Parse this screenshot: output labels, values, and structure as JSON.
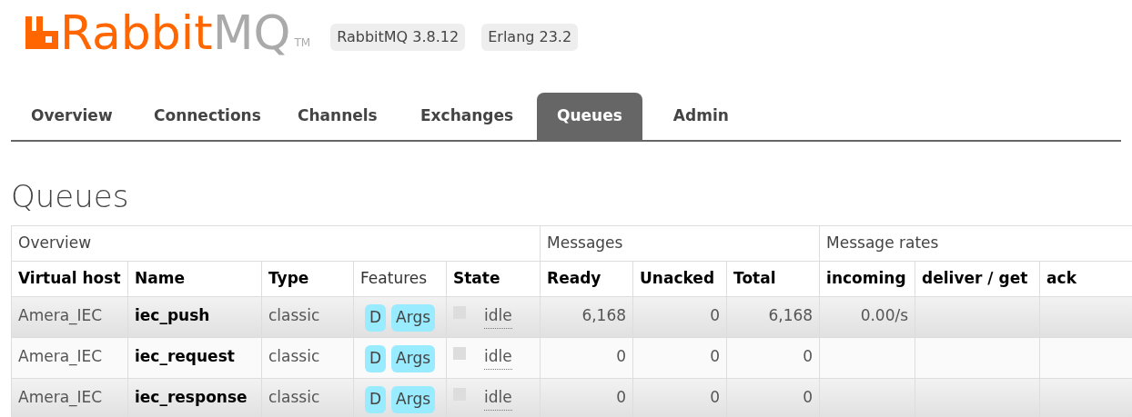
{
  "logo": {
    "brand": "Rabbit",
    "product": "MQ",
    "trademark": "TM"
  },
  "versions": [
    "RabbitMQ 3.8.12",
    "Erlang 23.2"
  ],
  "tabs": [
    {
      "label": "Overview",
      "selected": false
    },
    {
      "label": "Connections",
      "selected": false
    },
    {
      "label": "Channels",
      "selected": false
    },
    {
      "label": "Exchanges",
      "selected": false
    },
    {
      "label": "Queues",
      "selected": true
    },
    {
      "label": "Admin",
      "selected": false
    }
  ],
  "page_title": "Queues",
  "table": {
    "groups": [
      {
        "label": "Overview",
        "columns": [
          "Virtual host",
          "Name",
          "Type",
          "Features",
          "State"
        ]
      },
      {
        "label": "Messages",
        "columns": [
          "Ready",
          "Unacked",
          "Total"
        ]
      },
      {
        "label": "Message rates",
        "columns": [
          "incoming",
          "deliver / get",
          "ack"
        ]
      }
    ],
    "rows": [
      {
        "virtual_host": "Amera_IEC",
        "name": "iec_push",
        "type": "classic",
        "features": [
          "D",
          "Args"
        ],
        "state": "idle",
        "ready": "6,168",
        "unacked": "0",
        "total": "6,168",
        "incoming": "0.00/s"
      },
      {
        "virtual_host": "Amera_IEC",
        "name": "iec_request",
        "type": "classic",
        "features": [
          "D",
          "Args"
        ],
        "state": "idle",
        "ready": "0",
        "unacked": "0",
        "total": "0"
      },
      {
        "virtual_host": "Amera_IEC",
        "name": "iec_response",
        "type": "classic",
        "features": [
          "D",
          "Args"
        ],
        "state": "idle",
        "ready": "0",
        "unacked": "0",
        "total": "0"
      }
    ]
  }
}
